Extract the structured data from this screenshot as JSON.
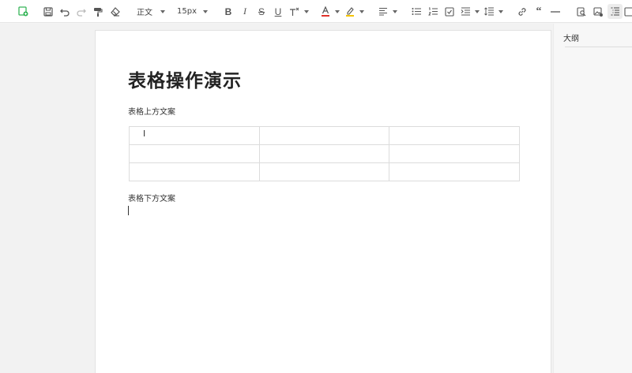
{
  "toolbar": {
    "paragraph_style": "正文",
    "font_size": "15px",
    "buttons": [
      "new-doc",
      "save",
      "undo",
      "redo",
      "format-painter",
      "clear-format",
      "bold",
      "italic",
      "strikethrough",
      "underline",
      "superscript",
      "font-color",
      "highlight",
      "align",
      "bullet-list",
      "ordered-list",
      "task-list",
      "indent",
      "line-height",
      "link",
      "quote",
      "horizontal-rule",
      "find",
      "image",
      "outline-toggle",
      "more"
    ],
    "accent": "#e0322a",
    "highlight_color": "#f5c400",
    "brand_green": "#35b558"
  },
  "document": {
    "title": "表格操作演示",
    "text_above": "表格上方文案",
    "text_below": "表格下方文案",
    "table": {
      "rows": 3,
      "cols": 3,
      "cells": [
        [
          "",
          "",
          ""
        ],
        [
          "",
          "",
          ""
        ],
        [
          "",
          "",
          ""
        ]
      ]
    }
  },
  "sidebar": {
    "title": "大纲"
  }
}
